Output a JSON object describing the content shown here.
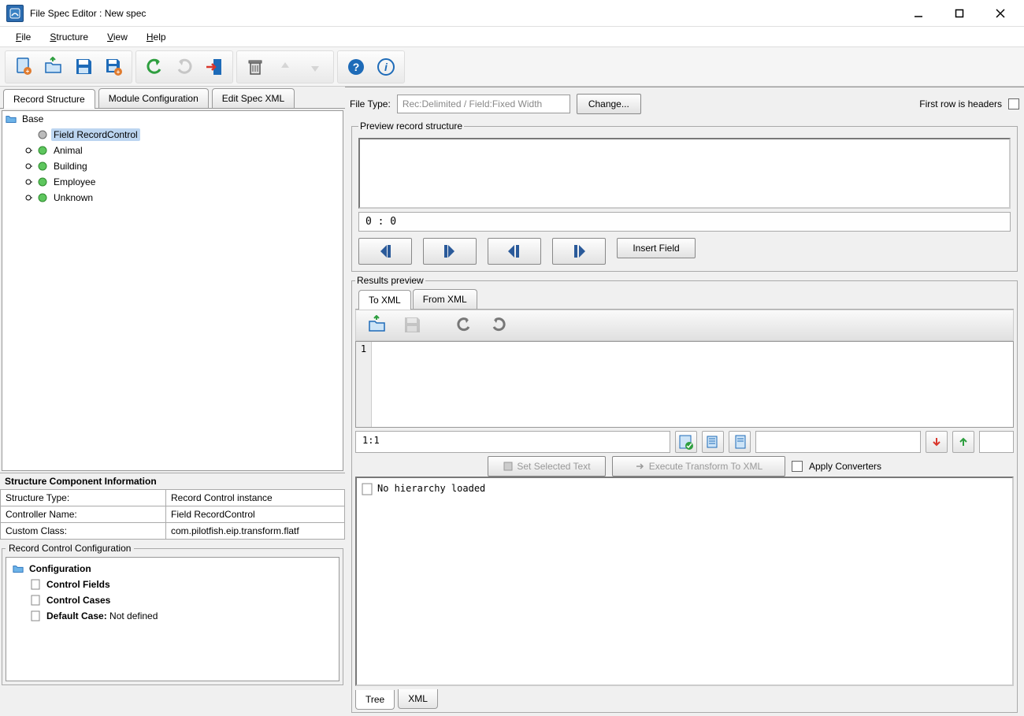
{
  "window": {
    "title": "File Spec Editor : New spec"
  },
  "menubar": [
    "File",
    "Structure",
    "View",
    "Help"
  ],
  "left_tabs": [
    "Record Structure",
    "Module Configuration",
    "Edit Spec XML"
  ],
  "active_left_tab": 0,
  "tree": {
    "root": "Base",
    "selected": "Field RecordControl",
    "nodes": [
      {
        "label": "Field RecordControl",
        "status": "gray"
      },
      {
        "label": "Animal",
        "status": "green"
      },
      {
        "label": "Building",
        "status": "green"
      },
      {
        "label": "Employee",
        "status": "green"
      },
      {
        "label": "Unknown",
        "status": "green"
      }
    ]
  },
  "info_section": {
    "title": "Structure Component Information",
    "rows": [
      {
        "label": "Structure Type:",
        "value": "Record Control instance"
      },
      {
        "label": "Controller Name:",
        "value": "Field RecordControl"
      },
      {
        "label": "Custom Class:",
        "value": "com.pilotfish.eip.transform.flatf"
      }
    ]
  },
  "record_control": {
    "legend": "Record Control Configuration",
    "nodes": {
      "root": "Configuration",
      "items": [
        "Control Fields",
        "Control Cases"
      ],
      "default_case_label": "Default Case:",
      "default_case_value": "Not defined"
    }
  },
  "right": {
    "file_type_label": "File Type:",
    "file_type_value": "Rec:Delimited / Field:Fixed Width",
    "change_btn": "Change...",
    "headers_label": "First row is headers",
    "headers_checked": false,
    "preview_legend": "Preview record structure",
    "pos_indicator": "0 : 0",
    "insert_field_btn": "Insert Field",
    "results_legend": "Results preview",
    "result_tabs": [
      "To XML",
      "From XML"
    ],
    "active_result_tab": 0,
    "editor_line": "1",
    "status_pos": "1:1",
    "set_selected_btn": "Set Selected Text",
    "execute_btn": "Execute Transform To XML",
    "apply_converters_label": "Apply Converters",
    "apply_converters_checked": false,
    "hierarchy_msg": "No hierarchy loaded",
    "bottom_tabs": [
      "Tree",
      "XML"
    ],
    "active_bottom_tab": 0
  }
}
